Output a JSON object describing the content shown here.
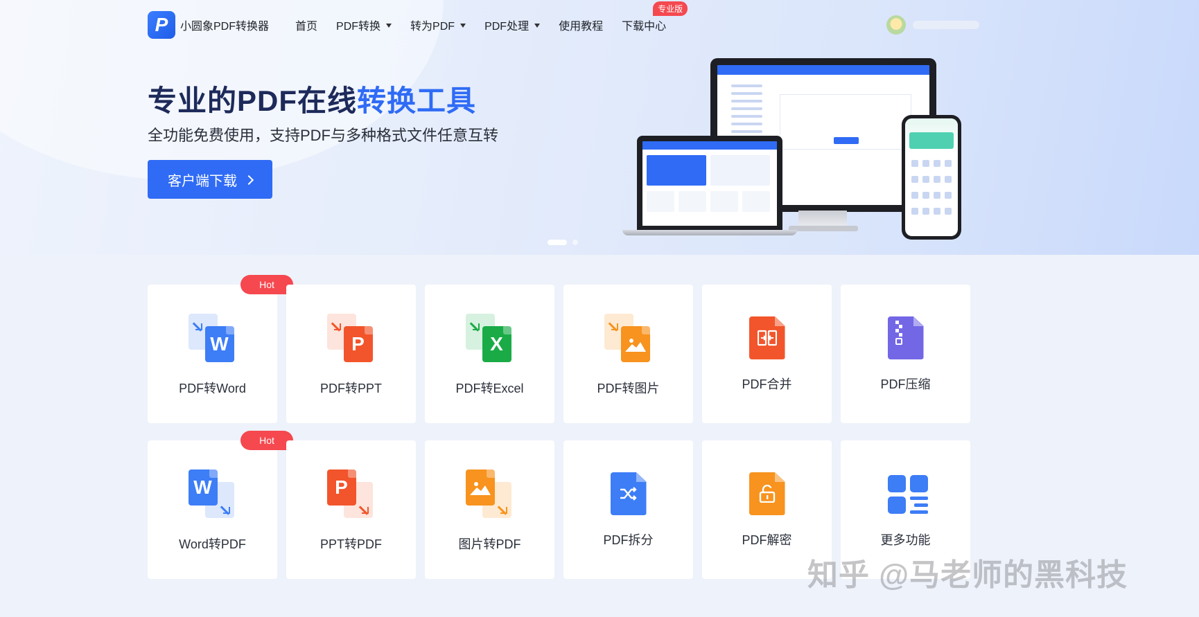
{
  "header": {
    "logo_letter": "P",
    "app_name": "小圆象PDF转换器",
    "nav": [
      {
        "label": "首页",
        "dropdown": false
      },
      {
        "label": "PDF转换",
        "dropdown": true
      },
      {
        "label": "转为PDF",
        "dropdown": true
      },
      {
        "label": "PDF处理",
        "dropdown": true
      },
      {
        "label": "使用教程",
        "dropdown": false
      },
      {
        "label": "下载中心",
        "dropdown": false,
        "badge": "专业版"
      }
    ]
  },
  "hero": {
    "title_part1": "专业的PDF在线",
    "title_part2": "转换工具",
    "subtitle": "全功能免费使用，支持PDF与多种格式文件任意互转",
    "cta_label": "客户端下载",
    "carousel_active": 1,
    "carousel_count": 2
  },
  "tools": [
    {
      "label": "PDF转Word",
      "hot": "Hot",
      "icon": "pdf-to-word-icon",
      "letter": "W",
      "color": "#3d7df6"
    },
    {
      "label": "PDF转PPT",
      "hot": null,
      "icon": "pdf-to-ppt-icon",
      "letter": "P",
      "color": "#f2552b"
    },
    {
      "label": "PDF转Excel",
      "hot": null,
      "icon": "pdf-to-excel-icon",
      "letter": "X",
      "color": "#1aab47"
    },
    {
      "label": "PDF转图片",
      "hot": null,
      "icon": "pdf-to-image-icon",
      "letter": "",
      "color": "#f7931e"
    },
    {
      "label": "PDF合并",
      "hot": null,
      "icon": "pdf-merge-icon",
      "letter": "",
      "color": "#f2552b"
    },
    {
      "label": "PDF压缩",
      "hot": null,
      "icon": "pdf-compress-icon",
      "letter": "",
      "color": "#7367e6"
    },
    {
      "label": "Word转PDF",
      "hot": "Hot",
      "icon": "word-to-pdf-icon",
      "letter": "W",
      "color": "#3d7df6"
    },
    {
      "label": "PPT转PDF",
      "hot": null,
      "icon": "ppt-to-pdf-icon",
      "letter": "P",
      "color": "#f2552b"
    },
    {
      "label": "图片转PDF",
      "hot": null,
      "icon": "image-to-pdf-icon",
      "letter": "",
      "color": "#f7931e"
    },
    {
      "label": "PDF拆分",
      "hot": null,
      "icon": "pdf-split-icon",
      "letter": "",
      "color": "#3d7df6"
    },
    {
      "label": "PDF解密",
      "hot": null,
      "icon": "pdf-decrypt-icon",
      "letter": "",
      "color": "#f7931e"
    },
    {
      "label": "更多功能",
      "hot": null,
      "icon": "more-functions-icon",
      "letter": "",
      "color": "#3d7df6"
    }
  ],
  "watermark": "知乎 @马老师的黑科技"
}
